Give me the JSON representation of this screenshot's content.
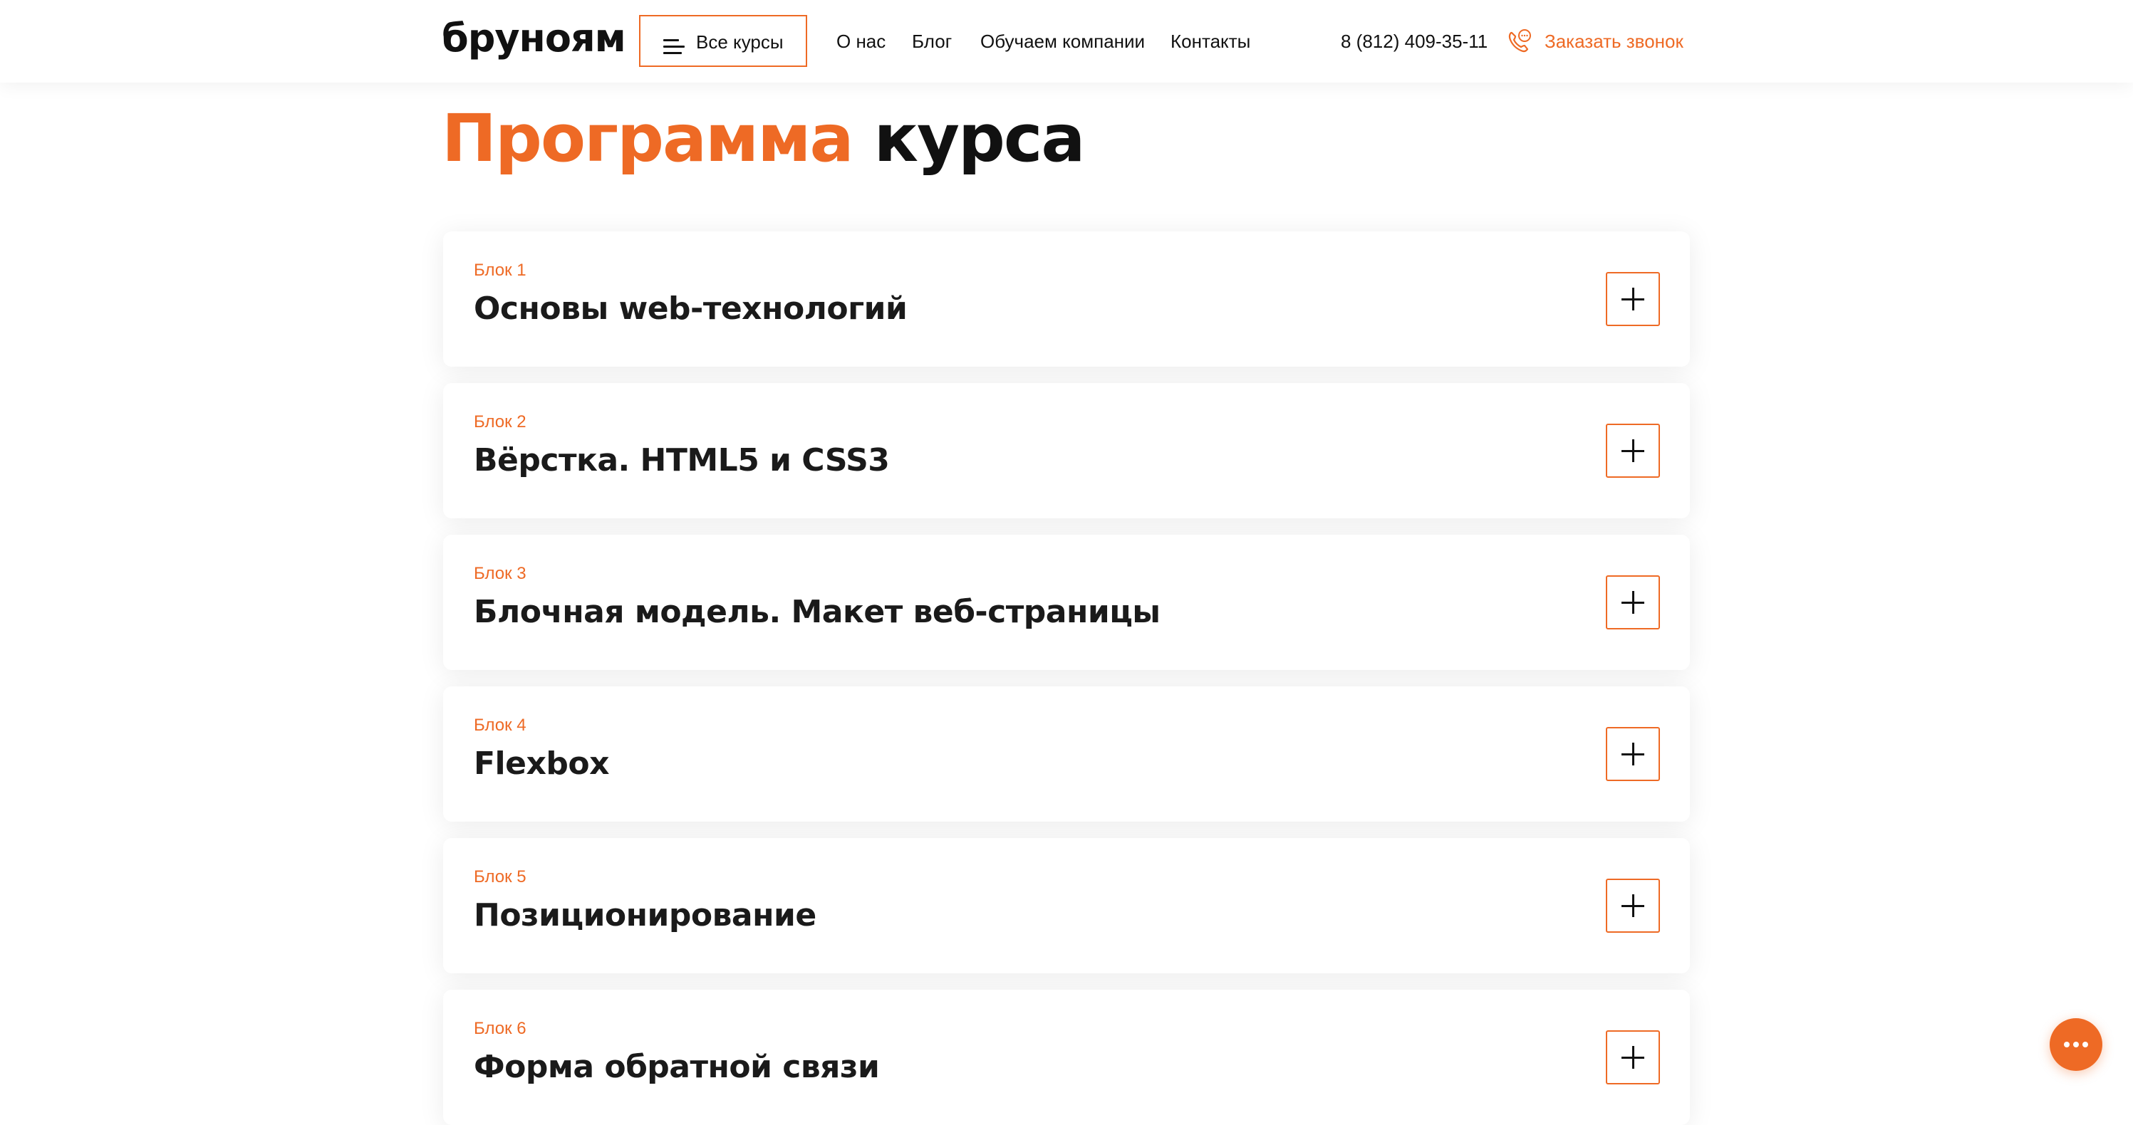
{
  "header": {
    "logo": "бруноям",
    "all_courses": "Все курсы",
    "nav": [
      "О нас",
      "Блог",
      "Обучаем компании",
      "Контакты"
    ],
    "phone": "8 (812) 409-35-11",
    "callback": "Заказать звонок"
  },
  "page": {
    "title_accent": "Программа",
    "title_rest": "курса"
  },
  "blocks": [
    {
      "label": "Блок 1",
      "title": "Основы web-технологий"
    },
    {
      "label": "Блок 2",
      "title": "Вёрстка. HTML5 и CSS3"
    },
    {
      "label": "Блок 3",
      "title": "Блочная модель. Макет веб-страницы"
    },
    {
      "label": "Блок 4",
      "title": "Flexbox"
    },
    {
      "label": "Блок 5",
      "title": "Позиционирование"
    },
    {
      "label": "Блок 6",
      "title": "Форма обратной связи"
    }
  ],
  "colors": {
    "accent": "#ee6a25",
    "text": "#111111"
  },
  "icons": {
    "menu": "burger-menu-icon",
    "call": "phone-call-icon",
    "expand": "plus-icon",
    "chat": "chat-dots-icon"
  }
}
